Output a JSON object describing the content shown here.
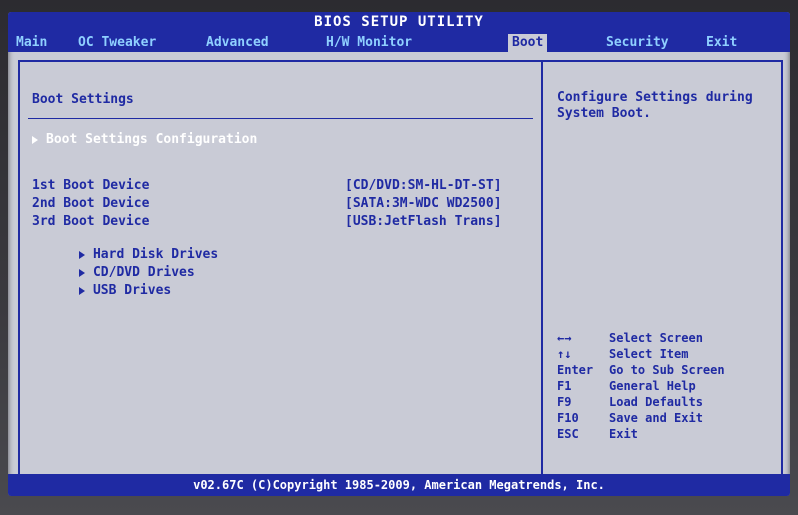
{
  "app": {
    "title": "BIOS SETUP UTILITY"
  },
  "tabs": [
    {
      "label": "Main",
      "active": false
    },
    {
      "label": "OC Tweaker",
      "active": false
    },
    {
      "label": "Advanced",
      "active": false
    },
    {
      "label": "H/W Monitor",
      "active": false
    },
    {
      "label": "Boot",
      "active": true
    },
    {
      "label": "Security",
      "active": false
    },
    {
      "label": "Exit",
      "active": false
    }
  ],
  "left": {
    "heading": "Boot Settings",
    "selected_item": "Boot Settings Configuration",
    "devices": [
      {
        "label": "1st Boot Device",
        "value": "[CD/DVD:SM-HL-DT-ST]"
      },
      {
        "label": "2nd Boot Device",
        "value": "[SATA:3M-WDC WD2500]"
      },
      {
        "label": "3rd Boot Device",
        "value": "[USB:JetFlash Trans]"
      }
    ],
    "submenus": [
      "Hard Disk Drives",
      "CD/DVD Drives",
      "USB Drives"
    ]
  },
  "right": {
    "help_text": "Configure Settings during System Boot.",
    "keys": [
      {
        "key": "←→",
        "desc": "Select Screen"
      },
      {
        "key": "↑↓",
        "desc": "Select Item"
      },
      {
        "key": "Enter",
        "desc": "Go to Sub Screen"
      },
      {
        "key": "F1",
        "desc": "General Help"
      },
      {
        "key": "F9",
        "desc": "Load Defaults"
      },
      {
        "key": "F10",
        "desc": "Save and Exit"
      },
      {
        "key": "ESC",
        "desc": "Exit"
      }
    ]
  },
  "footer": {
    "text": "v02.67C (C)Copyright 1985-2009, American Megatrends, Inc."
  },
  "colors": {
    "bios_blue": "#1f2aa3",
    "panel_gray": "#c9cbd6",
    "tab_text": "#8fd0ff",
    "highlight_text": "#ffffff"
  }
}
